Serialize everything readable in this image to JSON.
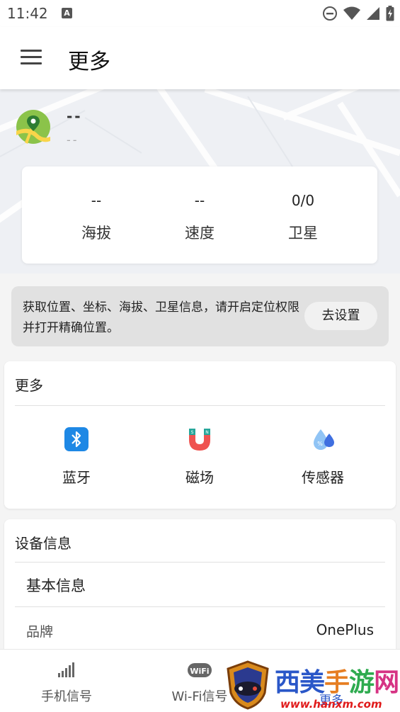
{
  "status_bar": {
    "time": "11:42",
    "notification_icon": "A",
    "icons": [
      "dnd-icon",
      "wifi-icon",
      "signal-icon",
      "battery-icon"
    ]
  },
  "app_bar": {
    "title": "更多",
    "menu_icon": "hamburger-menu-icon"
  },
  "location": {
    "name": "--",
    "subtitle": "--",
    "icon": "map-pin-icon"
  },
  "stats": [
    {
      "value": "--",
      "label": "海拔"
    },
    {
      "value": "--",
      "label": "速度"
    },
    {
      "value": "0/0",
      "label": "卫星"
    }
  ],
  "permission_banner": {
    "text": "获取位置、坐标、海拔、卫星信息，请开启定位权限并打开精确位置。",
    "button": "去设置"
  },
  "more_section": {
    "title": "更多",
    "tools": [
      {
        "label": "蓝牙",
        "icon": "bluetooth-icon"
      },
      {
        "label": "磁场",
        "icon": "magnet-icon"
      },
      {
        "label": "传感器",
        "icon": "water-drops-icon"
      }
    ]
  },
  "device_section": {
    "title": "设备信息",
    "subsection": "基本信息",
    "rows": [
      {
        "label": "品牌",
        "value": "OnePlus"
      }
    ]
  },
  "bottom_nav": [
    {
      "label": "手机信号",
      "icon": "signal-bars-icon"
    },
    {
      "label": "Wi-Fi信号",
      "icon": "wifi-badge-icon"
    },
    {
      "label": "更多",
      "icon": "more-icon"
    }
  ],
  "watermark": {
    "text": "西美手游网",
    "url": "www.hanxm.com"
  },
  "colors": {
    "primary_text": "#222222",
    "bluetooth_blue": "#1e88e5",
    "magnet_red": "#ef5350",
    "magnet_teal": "#26a69a",
    "drop_blue": "#5c8ef2"
  }
}
